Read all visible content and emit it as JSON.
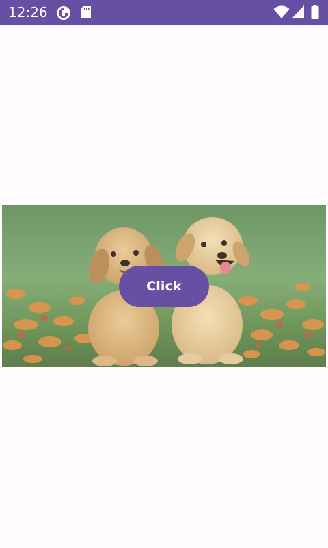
{
  "status_bar": {
    "time": "12:26",
    "background_color": "#6750a4",
    "left_icons": [
      "data-saver-icon",
      "sd-card-icon"
    ],
    "right_icons": [
      "wifi-icon",
      "cellular-signal-icon",
      "battery-icon"
    ]
  },
  "main": {
    "image": {
      "subject": "puppies-photo"
    },
    "button": {
      "label": "Click",
      "color": "#6750a4"
    }
  }
}
